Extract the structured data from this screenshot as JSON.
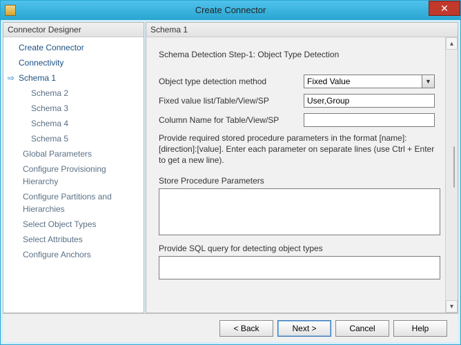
{
  "window": {
    "title": "Create Connector"
  },
  "left_panel": {
    "header": "Connector Designer",
    "items": [
      {
        "label": "Create Connector",
        "primary": true
      },
      {
        "label": "Connectivity",
        "primary": true
      },
      {
        "label": "Schema 1",
        "primary": true,
        "current": true
      },
      {
        "label": "Schema 2",
        "sub": true
      },
      {
        "label": "Schema 3",
        "sub": true
      },
      {
        "label": "Schema 4",
        "sub": true
      },
      {
        "label": "Schema 5",
        "sub": true
      },
      {
        "label": "Global Parameters"
      },
      {
        "label": "Configure Provisioning Hierarchy"
      },
      {
        "label": "Configure Partitions and Hierarchies"
      },
      {
        "label": "Select Object Types"
      },
      {
        "label": "Select Attributes"
      },
      {
        "label": "Configure Anchors"
      }
    ]
  },
  "right_panel": {
    "header": "Schema 1",
    "step_title": "Schema Detection Step-1: Object Type Detection",
    "labels": {
      "detection_method": "Object type detection method",
      "fixed_value_list": "Fixed value list/Table/View/SP",
      "column_name": "Column Name for Table/View/SP",
      "sp_params": "Store Procedure Parameters",
      "sql_query": "Provide SQL query for detecting object types"
    },
    "values": {
      "detection_method": "Fixed Value",
      "fixed_value_list": "User,Group",
      "column_name": ""
    },
    "help": "Provide required stored procedure parameters in the format [name]:[direction]:[value]. Enter each parameter on separate lines (use Ctrl + Enter to get a new line)."
  },
  "buttons": {
    "back": "<  Back",
    "next": "Next  >",
    "cancel": "Cancel",
    "help": "Help"
  }
}
